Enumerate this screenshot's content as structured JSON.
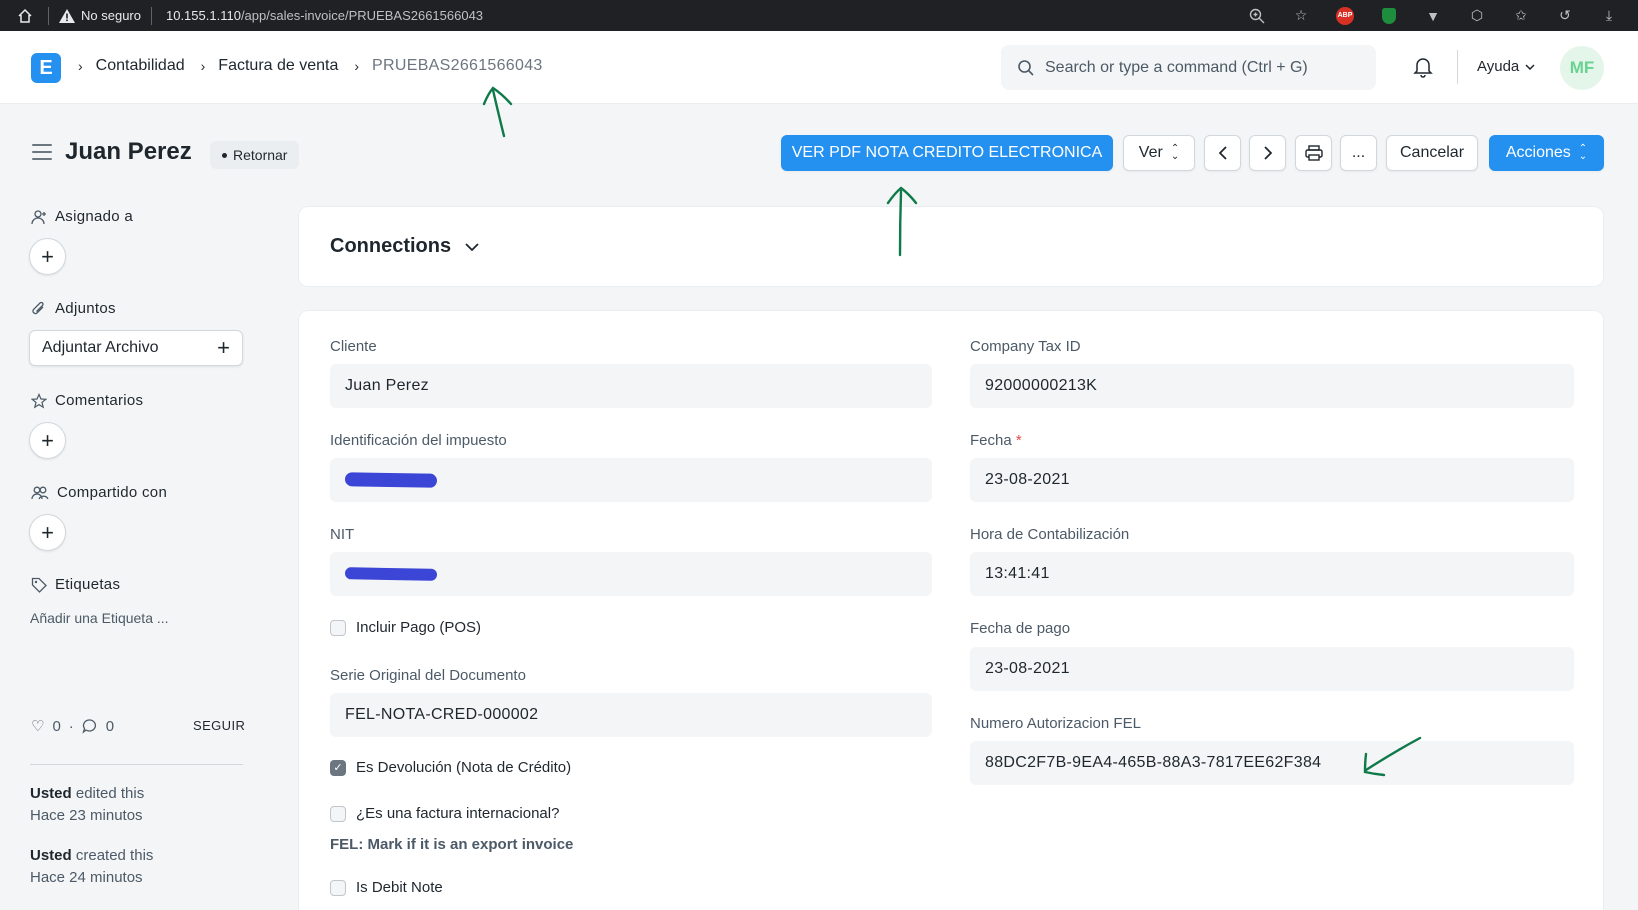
{
  "browser": {
    "security_label": "No seguro",
    "url_host": "10.155.1.110",
    "url_path": "/app/sales-invoice/PRUEBAS2661566043",
    "abp_badge": "ABP",
    "icons": [
      "home-icon",
      "warning-icon",
      "zoom-icon",
      "star-add-icon",
      "abp-icon",
      "shield-icon",
      "vivaldi-icon",
      "extensions-icon",
      "favorites-icon",
      "history-icon",
      "download-icon"
    ]
  },
  "navbar": {
    "logo_letter": "E",
    "breadcrumbs": [
      "Contabilidad",
      "Factura de venta",
      "PRUEBAS2661566043"
    ],
    "search_placeholder": "Search or type a command (Ctrl + G)",
    "help_label": "Ayuda",
    "avatar_initials": "MF"
  },
  "header": {
    "title": "Juan Perez",
    "status": "Retornar",
    "buttons": {
      "pdf": "VER PDF NOTA CREDITO ELECTRONICA",
      "view": "Ver",
      "more": "...",
      "cancel": "Cancelar",
      "actions": "Acciones"
    }
  },
  "sidebar": {
    "assigned": "Asignado a",
    "attachments": "Adjuntos",
    "attach_button": "Adjuntar Archivo",
    "comments": "Comentarios",
    "shared": "Compartido con",
    "tags": "Etiquetas",
    "add_tag": "Añadir una Etiqueta ...",
    "likes": "0",
    "comment_count": "0",
    "follow": "SEGUIR",
    "activity": [
      {
        "user": "Usted",
        "action": " edited this",
        "time": "Hace 23 minutos"
      },
      {
        "user": "Usted",
        "action": " created this",
        "time": "Hace 24 minutos"
      }
    ]
  },
  "connections": {
    "title": "Connections"
  },
  "form": {
    "left": {
      "cliente_label": "Cliente",
      "cliente_value": "Juan Perez",
      "tax_id_label": "Identificación del impuesto",
      "nit_label": "NIT",
      "pos_label": "Incluir Pago (POS)",
      "serie_label": "Serie Original del Documento",
      "serie_value": "FEL-NOTA-CRED-000002",
      "devolucion_label": "Es Devolución (Nota de Crédito)",
      "internacional_label": "¿Es una factura internacional?",
      "export_desc": "FEL: Mark if it is an export invoice",
      "debit_label": "Is Debit Note"
    },
    "right": {
      "company_tax_label": "Company Tax ID",
      "company_tax_value": "92000000213K",
      "fecha_label": "Fecha",
      "fecha_required": "*",
      "fecha_value": "23-08-2021",
      "hora_label": "Hora de Contabilización",
      "hora_value": "13:41:41",
      "fecha_pago_label": "Fecha de pago",
      "fecha_pago_value": "23-08-2021",
      "fel_label": "Numero Autorizacion FEL",
      "fel_value": "88DC2F7B-9EA4-465B-88A3-7817EE62F384"
    },
    "checkboxes": {
      "pos": false,
      "devolucion": true,
      "internacional": false,
      "debit": false
    }
  },
  "colors": {
    "primary": "#2490ef",
    "annotation_arrow": "#0e7a4a",
    "redaction": "#3b45d6"
  }
}
